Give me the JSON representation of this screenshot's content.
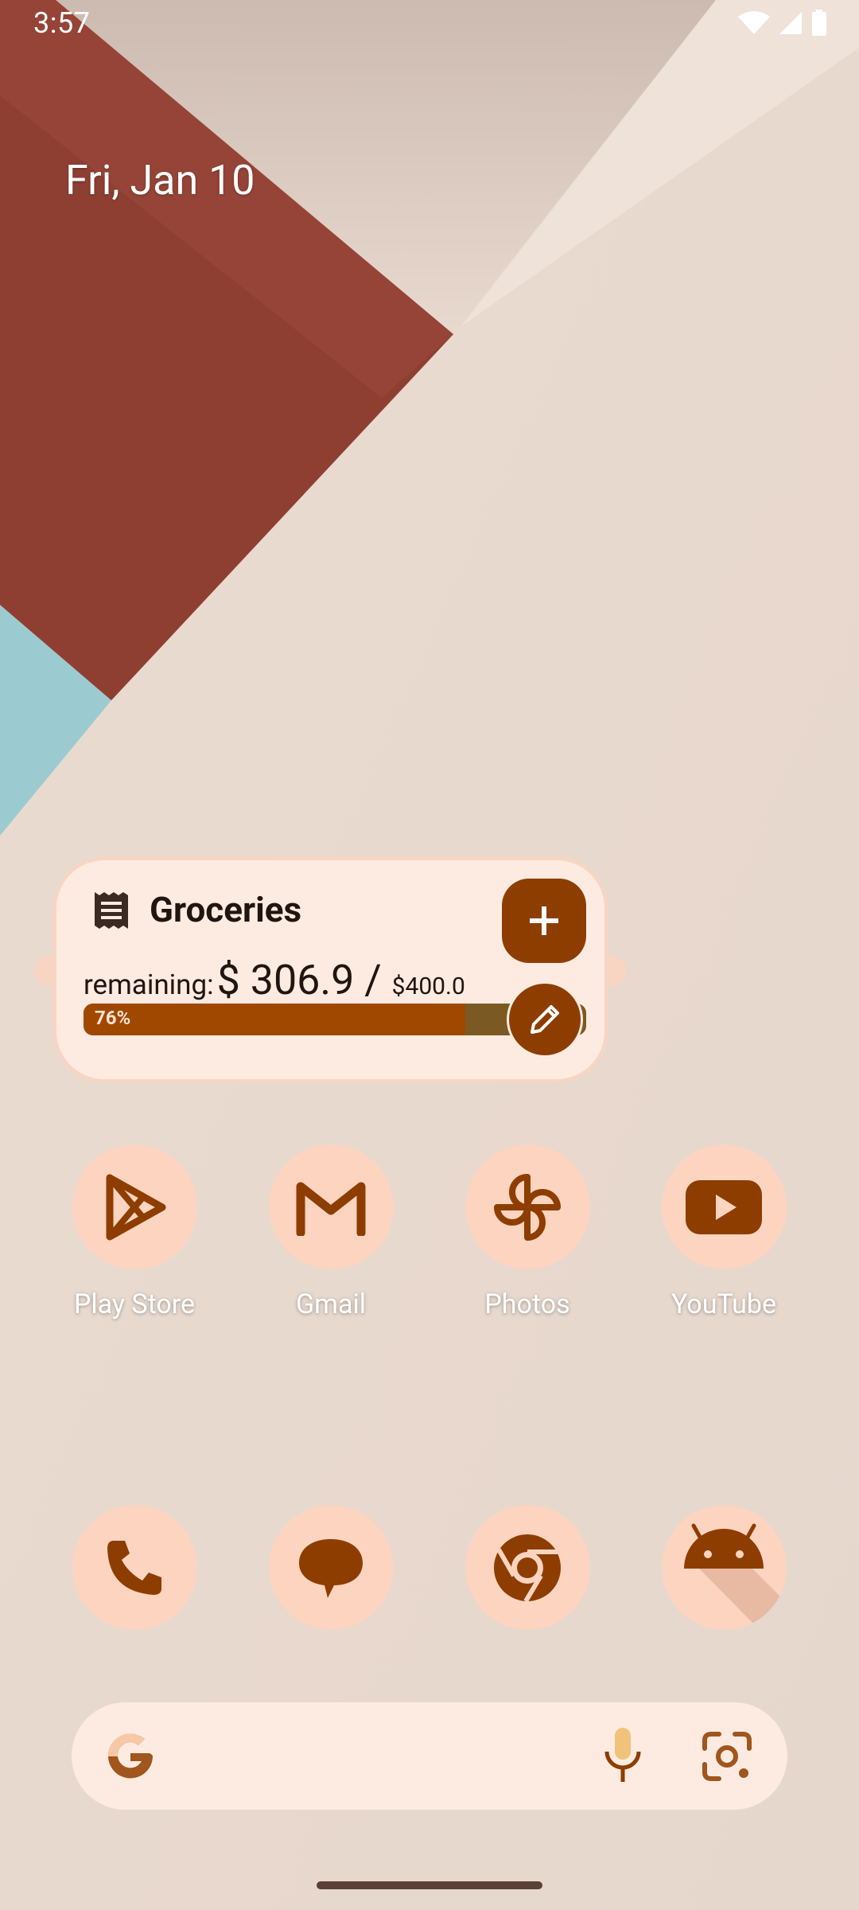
{
  "status_bar": {
    "time": "3:57"
  },
  "date": "Fri, Jan 10",
  "widget": {
    "title": "Groceries",
    "remaining_label": "remaining:",
    "remaining_amount": "$ 306.9 / ",
    "total": "$400.0",
    "progress_label": "76%",
    "progress_fraction": 0.76,
    "icon": "receipt-icon"
  },
  "apps": [
    {
      "label": "Play Store",
      "icon": "play-store-icon"
    },
    {
      "label": "Gmail",
      "icon": "gmail-icon"
    },
    {
      "label": "Photos",
      "icon": "photos-icon"
    },
    {
      "label": "YouTube",
      "icon": "youtube-icon"
    }
  ],
  "dock": [
    {
      "icon": "phone-icon"
    },
    {
      "icon": "messages-icon"
    },
    {
      "icon": "chrome-icon"
    },
    {
      "icon": "android-icon"
    }
  ],
  "colors": {
    "accent": "#8e3d00",
    "icon_background": "#fcd4c0",
    "widget_background": "#fdebe1"
  }
}
